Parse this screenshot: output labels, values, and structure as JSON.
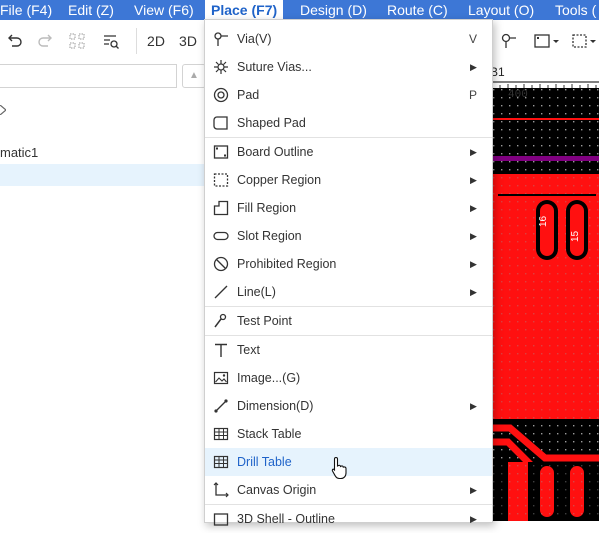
{
  "menubar": {
    "file": "File (F4)",
    "edit": "Edit (Z)",
    "view": "View (F6)",
    "place": "Place (F7)",
    "design": "Design (D)",
    "route": "Route (C)",
    "layout": "Layout (O)",
    "tools": "Tools ("
  },
  "toolbar": {
    "btn_2d": "2D",
    "btn_3d": "3D"
  },
  "left_panel": {
    "tree_label_partial": "matic1"
  },
  "canvas": {
    "tab_label": "B1",
    "ruler_400": "400",
    "pad_16": "16",
    "pad_15": "15"
  },
  "place_menu": [
    {
      "label": "Via(V)",
      "shortcut": "V"
    },
    {
      "label": "Suture Vias..."
    },
    {
      "label": "Pad",
      "shortcut": "P"
    },
    {
      "label": "Shaped Pad"
    },
    {
      "label": "Board Outline"
    },
    {
      "label": "Copper Region"
    },
    {
      "label": "Fill Region"
    },
    {
      "label": "Slot Region"
    },
    {
      "label": "Prohibited Region"
    },
    {
      "label": "Line(L)"
    },
    {
      "label": "Test Point"
    },
    {
      "label": "Text"
    },
    {
      "label": "Image...(G)"
    },
    {
      "label": "Dimension(D)"
    },
    {
      "label": "Stack Table"
    },
    {
      "label": "Drill Table"
    },
    {
      "label": "Canvas Origin"
    },
    {
      "label": "3D Shell - Outline"
    }
  ],
  "colors": {
    "menubar": "#3d77d6",
    "highlight_bg": "#e6f3fd",
    "highlight_text": "#1f63c9",
    "copper": "#ff1010",
    "silkscreen": "#800080"
  }
}
